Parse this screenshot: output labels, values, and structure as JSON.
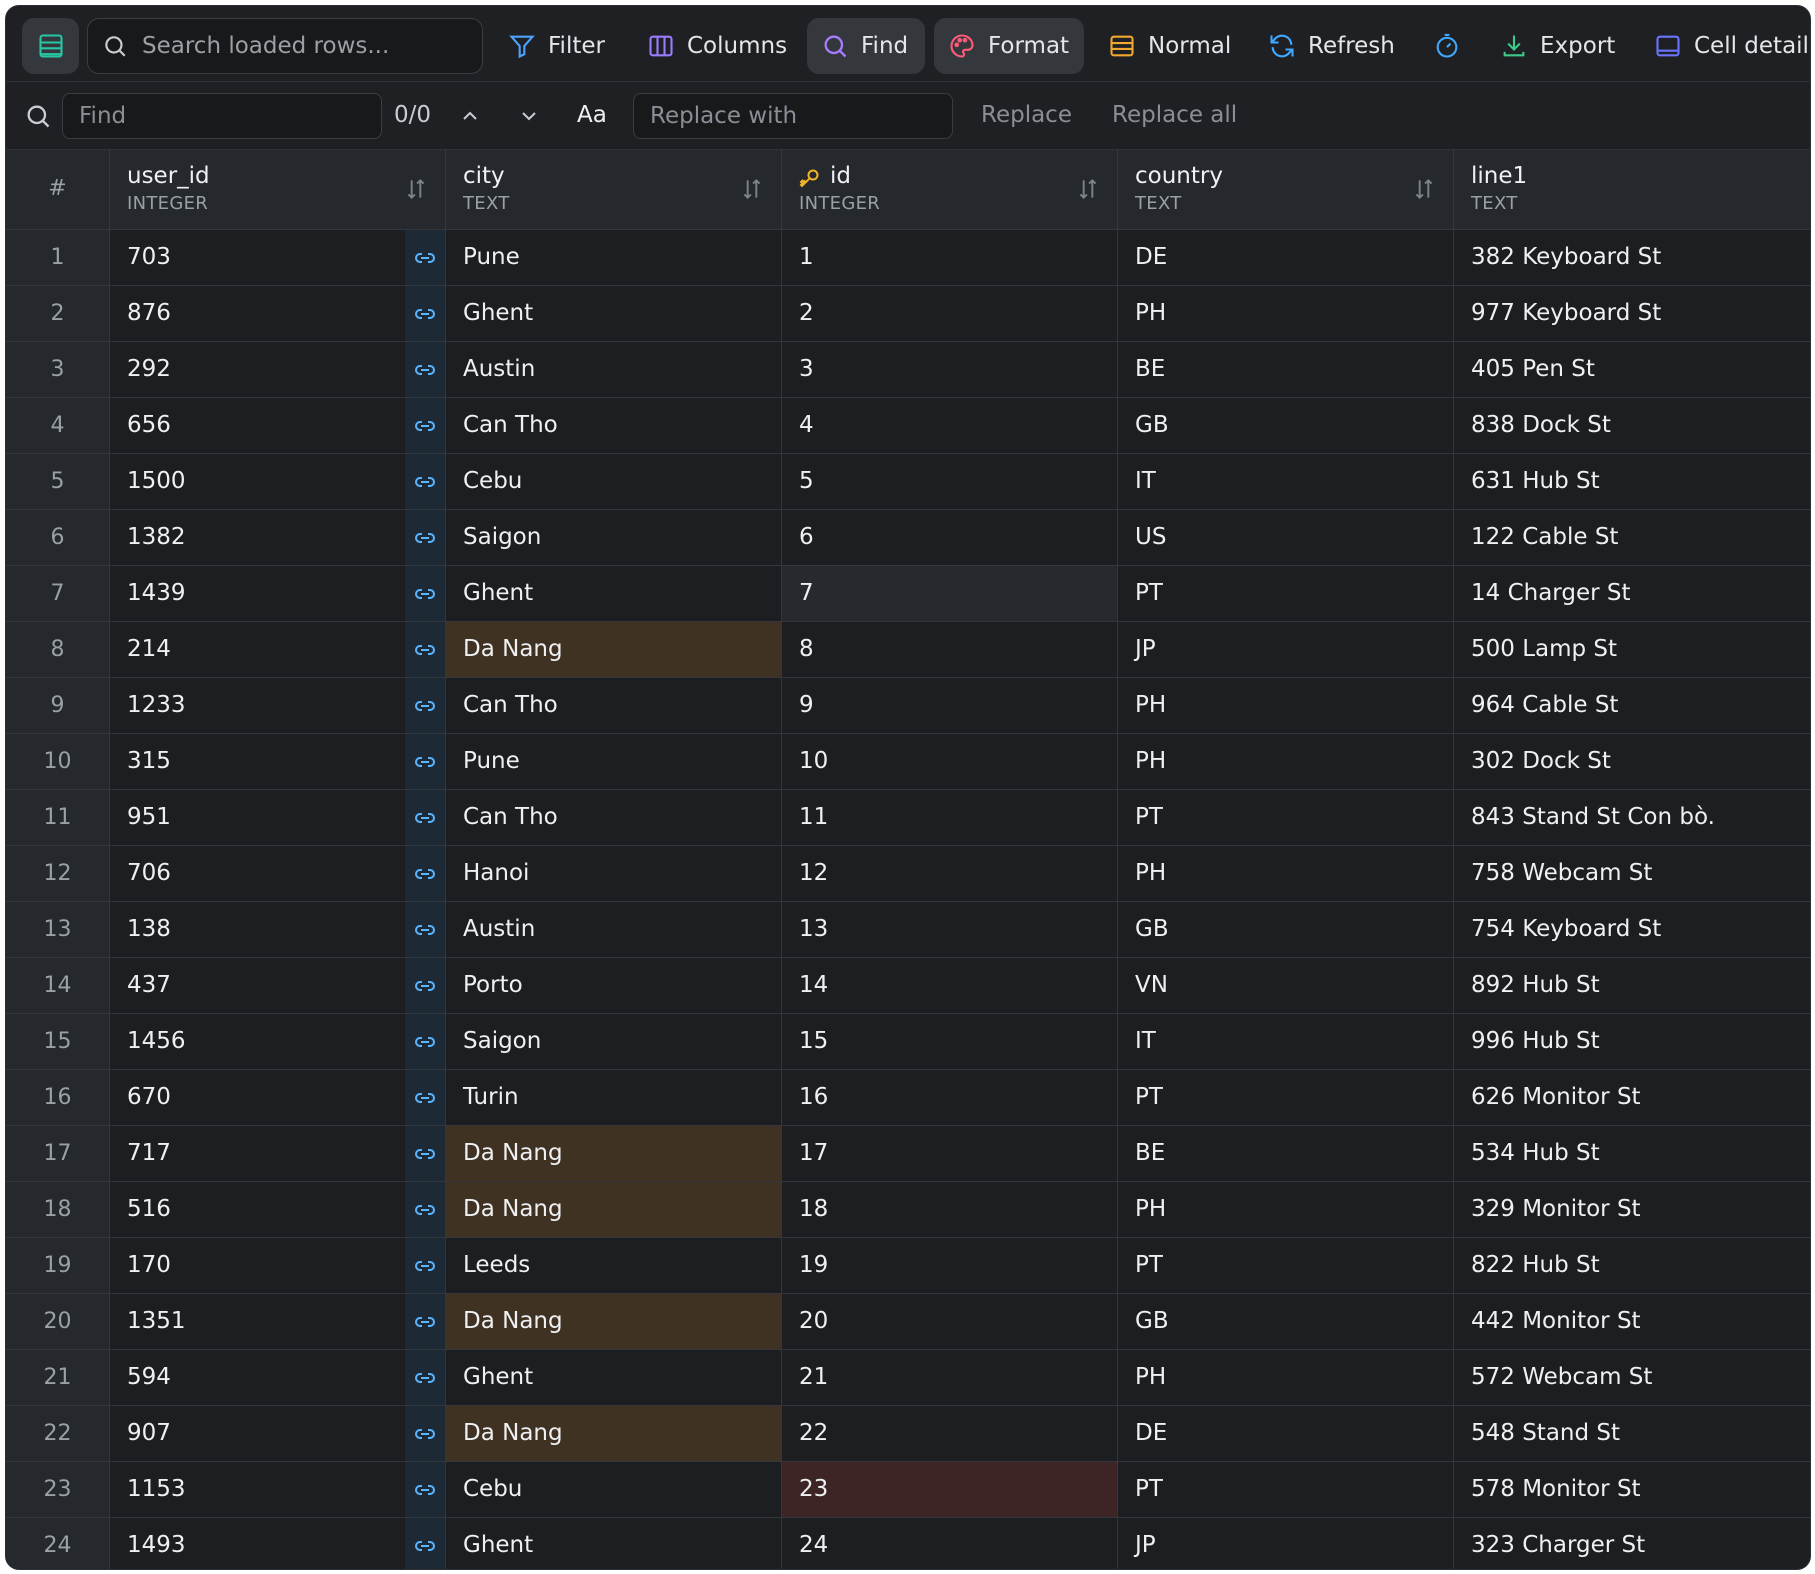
{
  "toolbar": {
    "search_placeholder": "Search loaded rows...",
    "filter_label": "Filter",
    "columns_label": "Columns",
    "find_label": "Find",
    "format_label": "Format",
    "normal_label": "Normal",
    "refresh_label": "Refresh",
    "export_label": "Export",
    "cell_detail_label": "Cell detail"
  },
  "findbar": {
    "find_placeholder": "Find",
    "match_count": "0/0",
    "case_label": "Aa",
    "replace_placeholder": "Replace with",
    "replace_label": "Replace",
    "replace_all_label": "Replace all"
  },
  "table": {
    "rownum_header": "#",
    "columns": [
      {
        "name": "user_id",
        "type": "INTEGER"
      },
      {
        "name": "city",
        "type": "TEXT"
      },
      {
        "name": "id",
        "type": "INTEGER"
      },
      {
        "name": "country",
        "type": "TEXT"
      },
      {
        "name": "line1",
        "type": "TEXT"
      }
    ],
    "rows": [
      {
        "n": "1",
        "user_id": "703",
        "city": "Pune",
        "id": "1",
        "country": "DE",
        "line1": "382 Keyboard St"
      },
      {
        "n": "2",
        "user_id": "876",
        "city": "Ghent",
        "id": "2",
        "country": "PH",
        "line1": "977 Keyboard St"
      },
      {
        "n": "3",
        "user_id": "292",
        "city": "Austin",
        "id": "3",
        "country": "BE",
        "line1": "405 Pen St"
      },
      {
        "n": "4",
        "user_id": "656",
        "city": "Can Tho",
        "id": "4",
        "country": "GB",
        "line1": "838 Dock St"
      },
      {
        "n": "5",
        "user_id": "1500",
        "city": "Cebu",
        "id": "5",
        "country": "IT",
        "line1": "631 Hub St"
      },
      {
        "n": "6",
        "user_id": "1382",
        "city": "Saigon",
        "id": "6",
        "country": "US",
        "line1": "122 Cable St"
      },
      {
        "n": "7",
        "user_id": "1439",
        "city": "Ghent",
        "id": "7",
        "country": "PT",
        "line1": "14 Charger St"
      },
      {
        "n": "8",
        "user_id": "214",
        "city": "Da Nang",
        "id": "8",
        "country": "JP",
        "line1": "500 Lamp St"
      },
      {
        "n": "9",
        "user_id": "1233",
        "city": "Can Tho",
        "id": "9",
        "country": "PH",
        "line1": "964 Cable St"
      },
      {
        "n": "10",
        "user_id": "315",
        "city": "Pune",
        "id": "10",
        "country": "PH",
        "line1": "302 Dock St"
      },
      {
        "n": "11",
        "user_id": "951",
        "city": "Can Tho",
        "id": "11",
        "country": "PT",
        "line1": "843 Stand St Con bò."
      },
      {
        "n": "12",
        "user_id": "706",
        "city": "Hanoi",
        "id": "12",
        "country": "PH",
        "line1": "758 Webcam St"
      },
      {
        "n": "13",
        "user_id": "138",
        "city": "Austin",
        "id": "13",
        "country": "GB",
        "line1": "754 Keyboard St"
      },
      {
        "n": "14",
        "user_id": "437",
        "city": "Porto",
        "id": "14",
        "country": "VN",
        "line1": "892 Hub St"
      },
      {
        "n": "15",
        "user_id": "1456",
        "city": "Saigon",
        "id": "15",
        "country": "IT",
        "line1": "996 Hub St"
      },
      {
        "n": "16",
        "user_id": "670",
        "city": "Turin",
        "id": "16",
        "country": "PT",
        "line1": "626 Monitor St"
      },
      {
        "n": "17",
        "user_id": "717",
        "city": "Da Nang",
        "id": "17",
        "country": "BE",
        "line1": "534 Hub St"
      },
      {
        "n": "18",
        "user_id": "516",
        "city": "Da Nang",
        "id": "18",
        "country": "PH",
        "line1": "329 Monitor St"
      },
      {
        "n": "19",
        "user_id": "170",
        "city": "Leeds",
        "id": "19",
        "country": "PT",
        "line1": "822 Hub St"
      },
      {
        "n": "20",
        "user_id": "1351",
        "city": "Da Nang",
        "id": "20",
        "country": "GB",
        "line1": "442 Monitor St"
      },
      {
        "n": "21",
        "user_id": "594",
        "city": "Ghent",
        "id": "21",
        "country": "PH",
        "line1": "572 Webcam St"
      },
      {
        "n": "22",
        "user_id": "907",
        "city": "Da Nang",
        "id": "22",
        "country": "DE",
        "line1": "548 Stand St"
      },
      {
        "n": "23",
        "user_id": "1153",
        "city": "Cebu",
        "id": "23",
        "country": "PT",
        "line1": "578 Monitor St"
      },
      {
        "n": "24",
        "user_id": "1493",
        "city": "Ghent",
        "id": "24",
        "country": "JP",
        "line1": "323 Charger St"
      }
    ]
  },
  "colors": {
    "frame_bg": "#1c1e21",
    "header_bg": "#25282c",
    "highlight_amber": "#3f3223",
    "highlight_red": "#3d2526",
    "fk_cell_bg": "#1d2a35",
    "accent_key_icon": "#f0b429"
  },
  "icons": {
    "menu": "table-grid-icon",
    "search": "search-icon",
    "filter": "funnel-icon",
    "columns": "columns-icon",
    "find": "search-icon",
    "format": "palette-icon",
    "normal": "rows-icon",
    "refresh": "refresh-icon",
    "timer": "stopwatch-icon",
    "export": "download-icon",
    "cell_detail": "panel-icon",
    "fk_link": "link-icon",
    "primary_key": "key-icon"
  }
}
